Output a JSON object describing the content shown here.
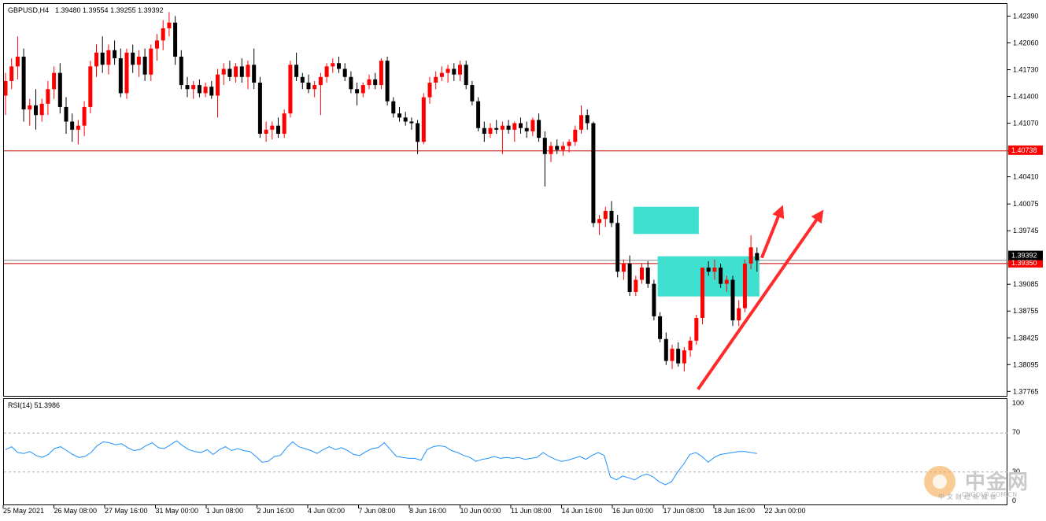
{
  "header": {
    "symbol_timeframe": "GBPUSD,H4",
    "ohlc": "1.39480 1.39554 1.39255 1.39392"
  },
  "rsi": {
    "label": "RSI(14) 51.3986",
    "levels": [
      "100",
      "70",
      "30",
      "0"
    ]
  },
  "price_axis": {
    "labels": [
      "1.42390",
      "1.42060",
      "1.41730",
      "1.41400",
      "1.41070",
      "1.40410",
      "1.40075",
      "1.39745",
      "1.39085",
      "1.38755",
      "1.38425",
      "1.38095",
      "1.37765"
    ],
    "tag_upper": "1.40738",
    "tag_lower": "1.39350",
    "current_tag": "1.39392"
  },
  "time_axis": {
    "labels": [
      "25 May 2021",
      "26 May 08:00",
      "27 May 16:00",
      "31 May 00:00",
      "1 Jun 08:00",
      "2 Jun 16:00",
      "4 Jun 00:00",
      "7 Jun 08:00",
      "8 Jun 16:00",
      "10 Jun 00:00",
      "11 Jun 08:00",
      "14 Jun 16:00",
      "16 Jun 00:00",
      "17 Jun 08:00",
      "18 Jun 16:00",
      "22 Jun 00:00"
    ]
  },
  "colors": {
    "bull": "#ff0000",
    "bear": "#000000",
    "hline": "#cc0000",
    "zone": "#40e0d0",
    "arrow": "#ff2a2a",
    "rsi_line": "#1e90ff",
    "tag_bg": "#ff0000"
  },
  "watermark": {
    "cn": "中金网",
    "sub": "中文财经新媒体",
    "domain": "CNGOLD.COM.CN"
  },
  "chart_data": {
    "type": "candlestick",
    "series": [
      {
        "name": "GBPUSD,H4",
        "ohlc": [
          [
            1.4142,
            1.417,
            1.4118,
            1.416
          ],
          [
            1.416,
            1.4188,
            1.415,
            1.4178
          ],
          [
            1.4178,
            1.4215,
            1.4162,
            1.419
          ],
          [
            1.419,
            1.42,
            1.411,
            1.4125
          ],
          [
            1.4125,
            1.4138,
            1.4105,
            1.413
          ],
          [
            1.413,
            1.415,
            1.41,
            1.4118
          ],
          [
            1.4118,
            1.4138,
            1.411,
            1.4132
          ],
          [
            1.4132,
            1.416,
            1.4118,
            1.415
          ],
          [
            1.415,
            1.4178,
            1.4138,
            1.417
          ],
          [
            1.417,
            1.4182,
            1.412,
            1.4128
          ],
          [
            1.4128,
            1.414,
            1.4095,
            1.411
          ],
          [
            1.411,
            1.412,
            1.4085,
            1.41
          ],
          [
            1.41,
            1.4112,
            1.4082,
            1.4105
          ],
          [
            1.4105,
            1.4135,
            1.4092,
            1.4128
          ],
          [
            1.4128,
            1.4185,
            1.412,
            1.4178
          ],
          [
            1.4178,
            1.4205,
            1.4165,
            1.4195
          ],
          [
            1.4195,
            1.4215,
            1.417,
            1.418
          ],
          [
            1.418,
            1.4205,
            1.4168,
            1.4198
          ],
          [
            1.4198,
            1.421,
            1.418,
            1.4188
          ],
          [
            1.4188,
            1.42,
            1.414,
            1.4145
          ],
          [
            1.4145,
            1.42,
            1.4138,
            1.4195
          ],
          [
            1.4195,
            1.4205,
            1.417,
            1.418
          ],
          [
            1.418,
            1.4198,
            1.4165,
            1.419
          ],
          [
            1.419,
            1.42,
            1.416,
            1.4168
          ],
          [
            1.4168,
            1.4205,
            1.416,
            1.42
          ],
          [
            1.42,
            1.4218,
            1.4185,
            1.421
          ],
          [
            1.421,
            1.4235,
            1.4198,
            1.4225
          ],
          [
            1.4225,
            1.4245,
            1.4215,
            1.4232
          ],
          [
            1.4232,
            1.424,
            1.418,
            1.419
          ],
          [
            1.419,
            1.4198,
            1.415,
            1.4155
          ],
          [
            1.4155,
            1.4165,
            1.414,
            1.415
          ],
          [
            1.415,
            1.416,
            1.4138,
            1.4155
          ],
          [
            1.4155,
            1.4162,
            1.414,
            1.4145
          ],
          [
            1.4145,
            1.4158,
            1.414,
            1.4153
          ],
          [
            1.4153,
            1.416,
            1.4138,
            1.4142
          ],
          [
            1.4142,
            1.4175,
            1.4115,
            1.4168
          ],
          [
            1.4168,
            1.4182,
            1.4155,
            1.4175
          ],
          [
            1.4175,
            1.4185,
            1.416,
            1.4165
          ],
          [
            1.4165,
            1.4182,
            1.4158,
            1.4178
          ],
          [
            1.4178,
            1.4188,
            1.4158,
            1.4165
          ],
          [
            1.4165,
            1.4185,
            1.415,
            1.418
          ],
          [
            1.418,
            1.42,
            1.415,
            1.4158
          ],
          [
            1.4158,
            1.4165,
            1.409,
            1.4095
          ],
          [
            1.4095,
            1.411,
            1.4085,
            1.41
          ],
          [
            1.41,
            1.411,
            1.4088,
            1.4105
          ],
          [
            1.4105,
            1.4115,
            1.409,
            1.4095
          ],
          [
            1.4095,
            1.4125,
            1.409,
            1.412
          ],
          [
            1.412,
            1.4185,
            1.4115,
            1.418
          ],
          [
            1.418,
            1.4195,
            1.416,
            1.4165
          ],
          [
            1.4165,
            1.417,
            1.415,
            1.4158
          ],
          [
            1.4158,
            1.4168,
            1.4145,
            1.415
          ],
          [
            1.415,
            1.416,
            1.414,
            1.4155
          ],
          [
            1.4155,
            1.417,
            1.4118,
            1.4165
          ],
          [
            1.4165,
            1.4182,
            1.4158,
            1.4178
          ],
          [
            1.4178,
            1.4188,
            1.417,
            1.4182
          ],
          [
            1.4182,
            1.419,
            1.417,
            1.4175
          ],
          [
            1.4175,
            1.4182,
            1.416,
            1.4165
          ],
          [
            1.4165,
            1.4172,
            1.4145,
            1.415
          ],
          [
            1.415,
            1.4158,
            1.413,
            1.4145
          ],
          [
            1.4145,
            1.4158,
            1.414,
            1.4155
          ],
          [
            1.4155,
            1.4168,
            1.415,
            1.4162
          ],
          [
            1.4162,
            1.417,
            1.415,
            1.4155
          ],
          [
            1.4155,
            1.4188,
            1.415,
            1.4185
          ],
          [
            1.4185,
            1.419,
            1.413,
            1.4135
          ],
          [
            1.4135,
            1.414,
            1.4115,
            1.412
          ],
          [
            1.412,
            1.4128,
            1.411,
            1.4115
          ],
          [
            1.4115,
            1.4122,
            1.4105,
            1.411
          ],
          [
            1.411,
            1.4115,
            1.41,
            1.4108
          ],
          [
            1.4108,
            1.4112,
            1.407,
            1.4085
          ],
          [
            1.4085,
            1.4145,
            1.4082,
            1.414
          ],
          [
            1.414,
            1.4165,
            1.4132,
            1.4158
          ],
          [
            1.4158,
            1.4172,
            1.415,
            1.4165
          ],
          [
            1.4165,
            1.4178,
            1.416,
            1.417
          ],
          [
            1.417,
            1.418,
            1.4158,
            1.4175
          ],
          [
            1.4175,
            1.4182,
            1.416,
            1.4168
          ],
          [
            1.4168,
            1.4185,
            1.416,
            1.418
          ],
          [
            1.418,
            1.4185,
            1.415,
            1.4155
          ],
          [
            1.4155,
            1.416,
            1.413,
            1.4135
          ],
          [
            1.4135,
            1.414,
            1.4098,
            1.4102
          ],
          [
            1.4102,
            1.411,
            1.4085,
            1.4095
          ],
          [
            1.4095,
            1.4108,
            1.409,
            1.4102
          ],
          [
            1.4102,
            1.4112,
            1.4095,
            1.41
          ],
          [
            1.41,
            1.411,
            1.407,
            1.4105
          ],
          [
            1.4105,
            1.4112,
            1.4095,
            1.41
          ],
          [
            1.41,
            1.411,
            1.4085,
            1.4108
          ],
          [
            1.4108,
            1.4115,
            1.4095,
            1.4102
          ],
          [
            1.4102,
            1.411,
            1.409,
            1.4098
          ],
          [
            1.4098,
            1.4115,
            1.4092,
            1.4112
          ],
          [
            1.4112,
            1.412,
            1.4085,
            1.409
          ],
          [
            1.409,
            1.4098,
            1.403,
            1.407
          ],
          [
            1.407,
            1.4085,
            1.406,
            1.408
          ],
          [
            1.408,
            1.4088,
            1.407,
            1.4075
          ],
          [
            1.4075,
            1.4085,
            1.4068,
            1.408
          ],
          [
            1.408,
            1.4088,
            1.4072,
            1.4085
          ],
          [
            1.4085,
            1.4105,
            1.408,
            1.41
          ],
          [
            1.41,
            1.413,
            1.4095,
            1.4118
          ],
          [
            1.4118,
            1.4125,
            1.41,
            1.4108
          ],
          [
            1.4108,
            1.411,
            1.398,
            1.3985
          ],
          [
            1.3985,
            1.3995,
            1.397,
            1.399
          ],
          [
            1.399,
            1.4005,
            1.398,
            1.4
          ],
          [
            1.4,
            1.4012,
            1.398,
            1.3985
          ],
          [
            1.3985,
            1.3995,
            1.3918,
            1.3925
          ],
          [
            1.3925,
            1.394,
            1.3915,
            1.3935
          ],
          [
            1.3935,
            1.3945,
            1.3895,
            1.39
          ],
          [
            1.39,
            1.392,
            1.3895,
            1.3915
          ],
          [
            1.3915,
            1.3935,
            1.391,
            1.393
          ],
          [
            1.393,
            1.3938,
            1.3905,
            1.391
          ],
          [
            1.391,
            1.3915,
            1.3865,
            1.387
          ],
          [
            1.387,
            1.3875,
            1.3838,
            1.3842
          ],
          [
            1.3842,
            1.385,
            1.381,
            1.3815
          ],
          [
            1.3815,
            1.3835,
            1.3805,
            1.383
          ],
          [
            1.383,
            1.3838,
            1.3808,
            1.3812
          ],
          [
            1.3812,
            1.3832,
            1.3802,
            1.3828
          ],
          [
            1.3828,
            1.3845,
            1.382,
            1.384
          ],
          [
            1.384,
            1.3872,
            1.3835,
            1.3868
          ],
          [
            1.3868,
            1.3915,
            1.386,
            1.393
          ],
          [
            1.393,
            1.3938,
            1.392,
            1.3925
          ],
          [
            1.3925,
            1.394,
            1.3915,
            1.393
          ],
          [
            1.393,
            1.3935,
            1.3905,
            1.391
          ],
          [
            1.391,
            1.392,
            1.39,
            1.3915
          ],
          [
            1.3915,
            1.392,
            1.3858,
            1.3865
          ],
          [
            1.3865,
            1.389,
            1.3858,
            1.388
          ],
          [
            1.388,
            1.394,
            1.3875,
            1.3935
          ],
          [
            1.3935,
            1.397,
            1.3928,
            1.3955
          ],
          [
            1.3948,
            1.3955,
            1.3925,
            1.3939
          ]
        ]
      }
    ],
    "y_range": [
      1.377,
      1.4255
    ],
    "horizontal_lines": [
      1.40738,
      1.3935,
      1.39392
    ],
    "zones": [
      {
        "x_from": 104,
        "x_to": 114,
        "y_from": 1.39715,
        "y_to": 1.4005
      },
      {
        "x_from": 108,
        "x_to": 124,
        "y_from": 1.38945,
        "y_to": 1.3944
      }
    ],
    "rsi": {
      "levels": [
        70,
        30
      ],
      "range": [
        0,
        100
      ],
      "values": [
        53,
        56,
        50,
        49,
        51,
        47,
        45,
        48,
        54,
        56,
        52,
        48,
        45,
        46,
        50,
        57,
        61,
        60,
        58,
        59,
        55,
        52,
        53,
        57,
        60,
        55,
        54,
        58,
        62,
        57,
        53,
        51,
        50,
        53,
        48,
        53,
        56,
        52,
        54,
        52,
        51,
        46,
        40,
        41,
        46,
        47,
        55,
        61,
        56,
        54,
        52,
        49,
        53,
        56,
        53,
        55,
        52,
        48,
        47,
        51,
        54,
        55,
        60,
        53,
        46,
        45,
        44,
        44,
        42,
        53,
        56,
        57,
        56,
        52,
        50,
        47,
        45,
        41,
        43,
        44,
        46,
        44,
        45,
        44,
        45,
        43,
        44,
        45,
        50,
        46,
        43,
        41,
        42,
        44,
        46,
        43,
        47,
        50,
        47,
        25,
        22,
        26,
        24,
        22,
        26,
        28,
        25,
        20,
        17,
        20,
        30,
        38,
        48,
        50,
        46,
        40,
        45,
        48,
        49,
        50,
        51,
        51,
        50,
        49
      ]
    }
  }
}
